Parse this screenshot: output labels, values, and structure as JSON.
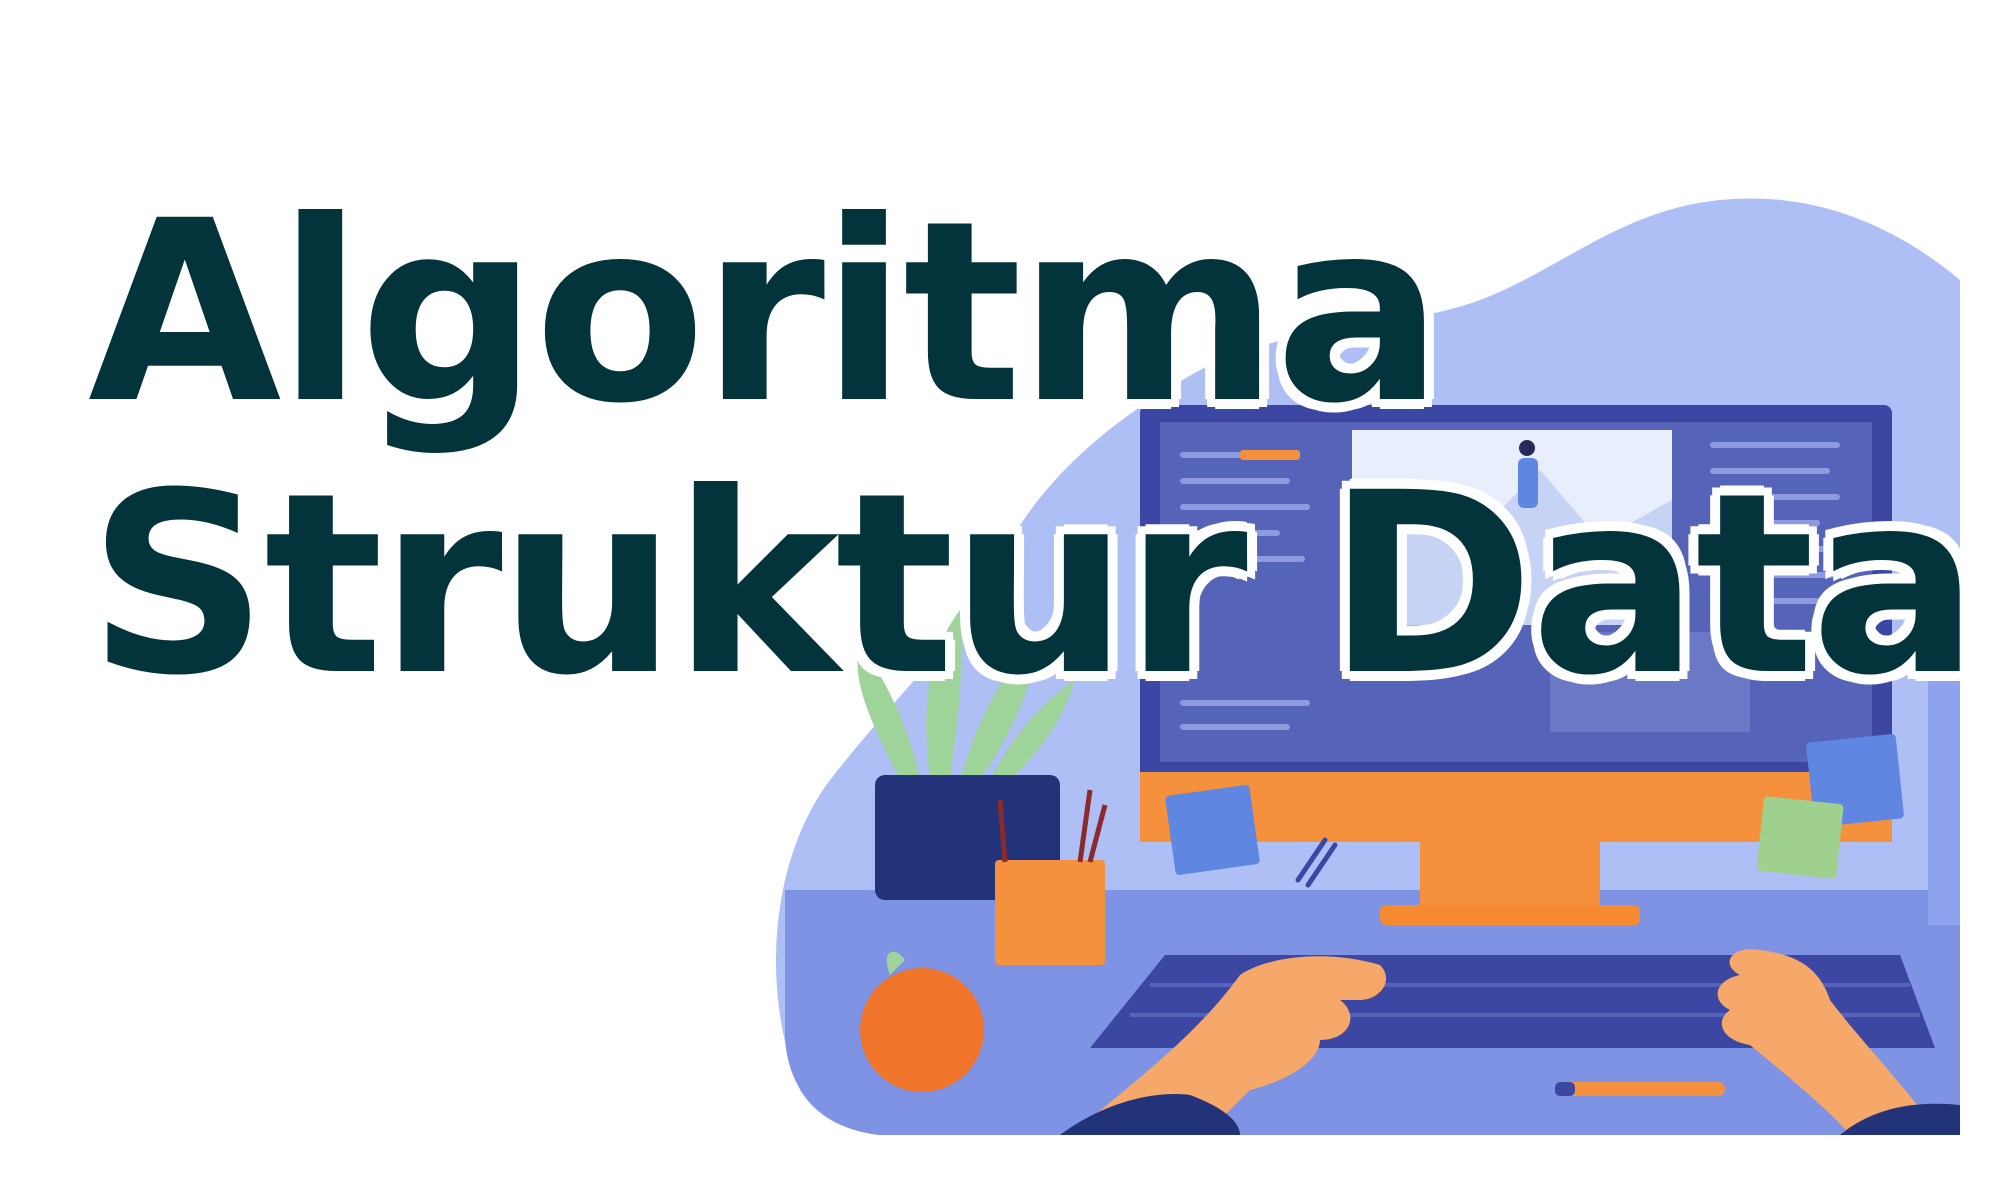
{
  "title": {
    "line1": "Algoritma",
    "line2": "Struktur Data"
  },
  "illustration": {
    "subject": "person-typing-at-computer",
    "colors": {
      "title_text": "#03333b",
      "background_blob": "#aebff5",
      "monitor_frame": "#3b47a3",
      "monitor_screen": "#5563b8",
      "monitor_stand": "#f5913c",
      "desk": "#7e93e4",
      "keyboard": "#3b47a3",
      "skin": "#f5a86a",
      "plant_leaves": "#9ed39a",
      "pot": "#23337a",
      "orange": "#f0742a",
      "sticky_note_blue": "#5f86e0",
      "sticky_note_green": "#9fd08e"
    }
  }
}
